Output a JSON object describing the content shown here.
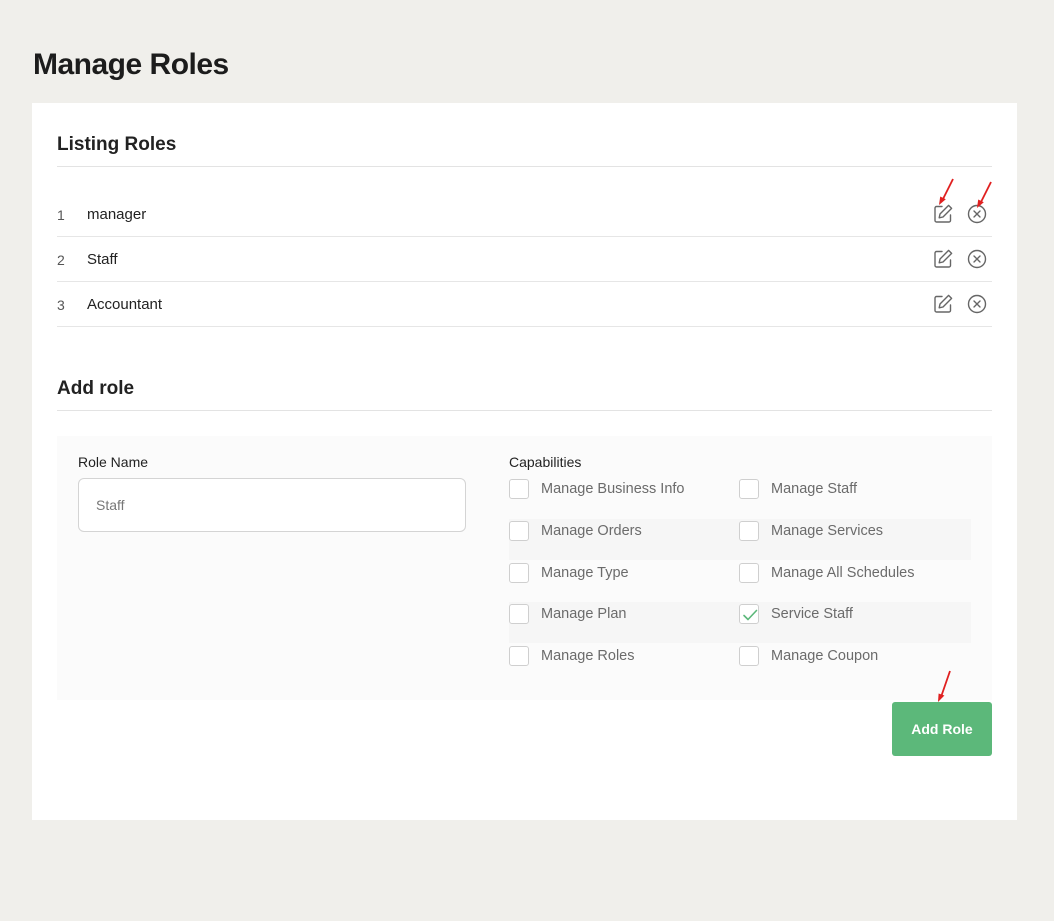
{
  "page": {
    "title": "Manage Roles"
  },
  "listing": {
    "title": "Listing Roles",
    "roles": [
      {
        "index": "1",
        "name": "manager"
      },
      {
        "index": "2",
        "name": "Staff"
      },
      {
        "index": "3",
        "name": "Accountant"
      }
    ]
  },
  "add_role": {
    "title": "Add role",
    "role_name_label": "Role Name",
    "role_name_placeholder": "Staff",
    "capabilities_label": "Capabilities",
    "capabilities": [
      {
        "label": "Manage Business Info",
        "checked": false
      },
      {
        "label": "Manage Staff",
        "checked": false
      },
      {
        "label": "Manage Orders",
        "checked": false
      },
      {
        "label": "Manage Services",
        "checked": false
      },
      {
        "label": "Manage Type",
        "checked": false
      },
      {
        "label": "Manage All Schedules",
        "checked": false
      },
      {
        "label": "Manage Plan",
        "checked": false
      },
      {
        "label": "Service Staff",
        "checked": true
      },
      {
        "label": "Manage Roles",
        "checked": false
      },
      {
        "label": "Manage Coupon",
        "checked": false
      }
    ],
    "submit_label": "Add Role"
  },
  "icons": {
    "edit": "pencil-square-icon",
    "delete": "circle-x-icon",
    "annotation": "red-arrow-icon"
  },
  "colors": {
    "background": "#f0efeb",
    "card": "#ffffff",
    "accent_green": "#5cb87a",
    "annotation_red": "#e02020"
  }
}
